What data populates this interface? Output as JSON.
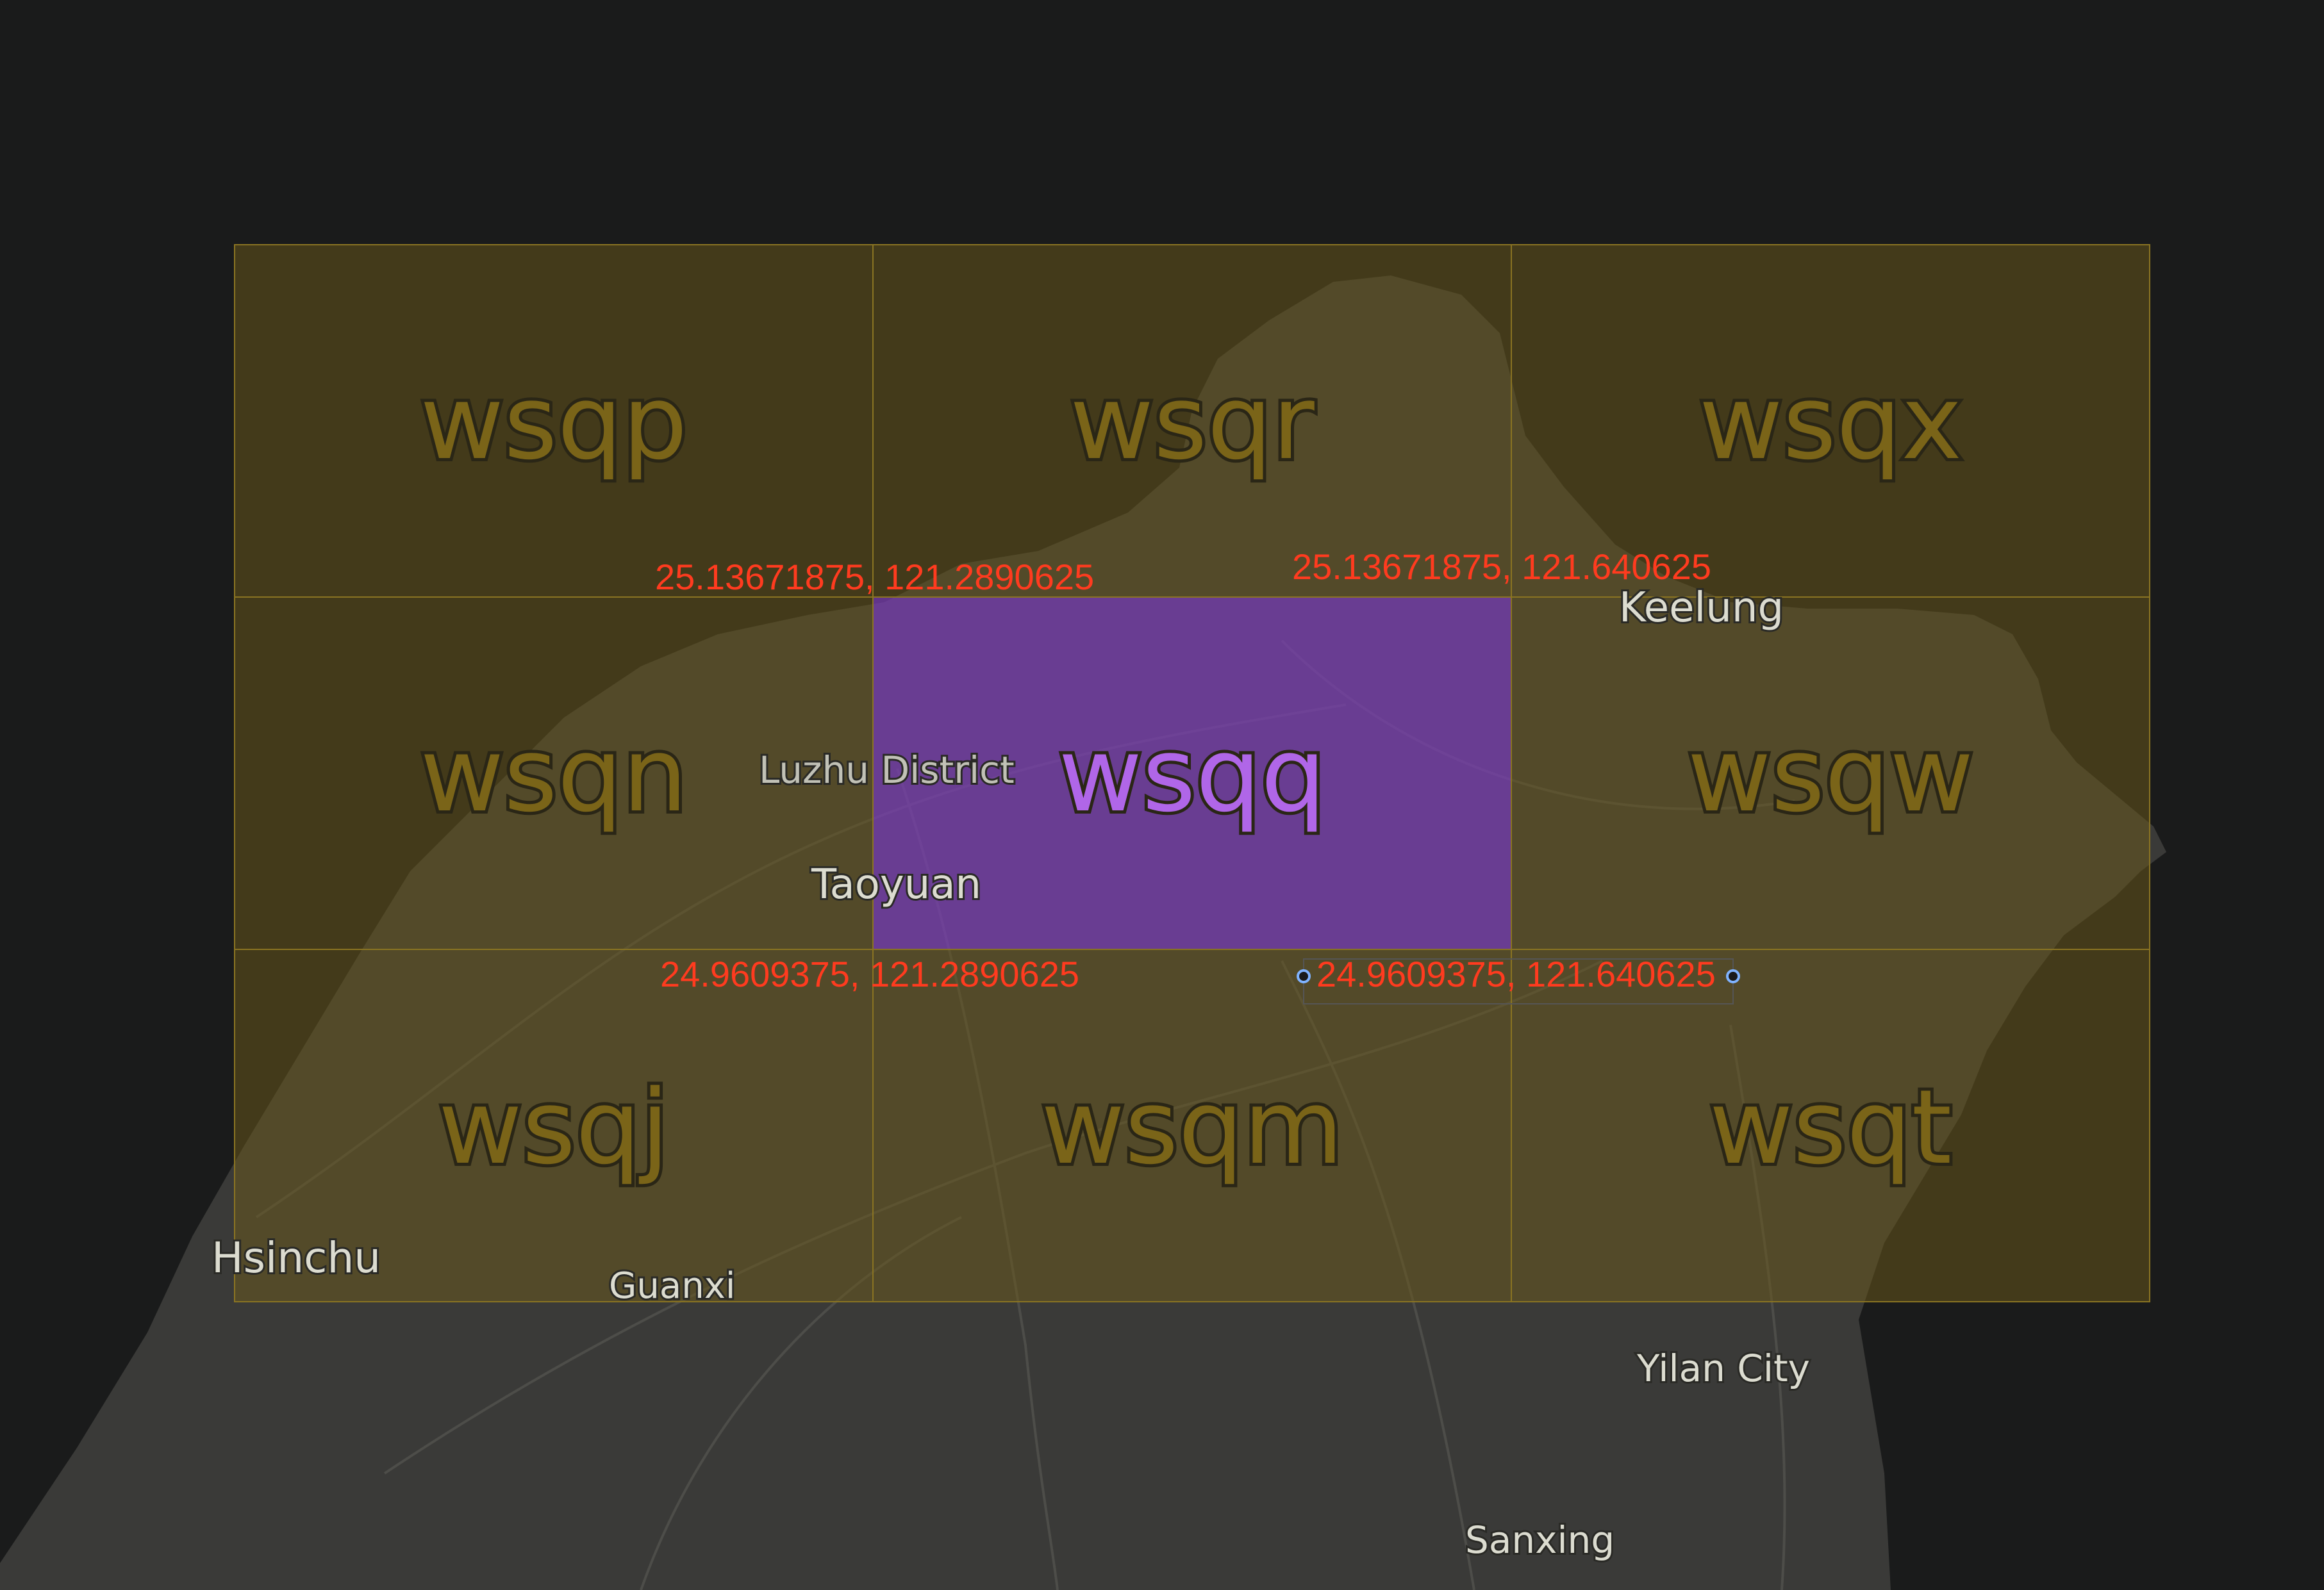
{
  "geohash_grid": {
    "selected": "wsqq",
    "cells": [
      {
        "hash": "wsqp",
        "selected": false
      },
      {
        "hash": "wsqr",
        "selected": false
      },
      {
        "hash": "wsqx",
        "selected": false
      },
      {
        "hash": "wsqn",
        "selected": false
      },
      {
        "hash": "wsqq",
        "selected": true
      },
      {
        "hash": "wsqw",
        "selected": false
      },
      {
        "hash": "wsqj",
        "selected": false
      },
      {
        "hash": "wsqm",
        "selected": false
      },
      {
        "hash": "wsqt",
        "selected": false
      }
    ],
    "corner_labels": {
      "top_left": "25.13671875, 121.2890625",
      "top_right": "25.13671875, 121.640625",
      "bottom_left": "24.9609375,  121.2890625",
      "bottom_right": "24.9609375, 121.640625"
    }
  },
  "places": {
    "keelung": "Keelung",
    "luzhu": "Luzhu District",
    "taoyuan": "Taoyuan",
    "hsinchu": "Hsinchu",
    "guanxi": "Guanxi",
    "yilan": "Yilan City",
    "sanxing": "Sanxing"
  },
  "colors": {
    "background": "#1a1b1b",
    "land": "#3a3a38",
    "grid_fill": "#6b5a1a",
    "grid_line": "#8a7422",
    "cell_text": "#7a6418",
    "selected_fill": "#7a3fb0",
    "selected_text": "#b066e8",
    "coord_text": "#ff3b1f"
  }
}
